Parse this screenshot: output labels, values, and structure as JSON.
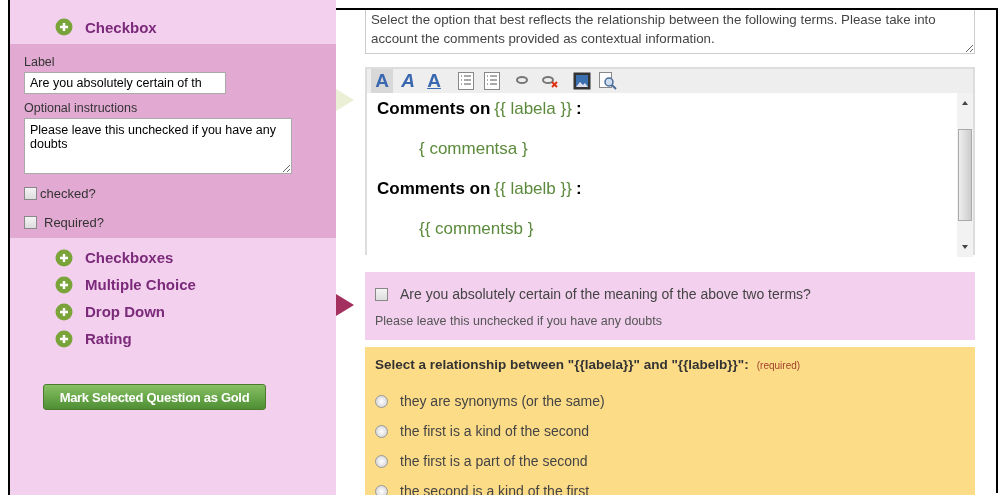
{
  "sidebar": {
    "items": [
      {
        "label": "Checkbox",
        "expanded": true,
        "editor": {
          "label_caption": "Label",
          "label_value": "Are you absolutely certain of th",
          "instructions_caption": "Optional instructions",
          "instructions_value": "Please leave this unchecked if you have any doubts",
          "options": [
            {
              "label": "checked?",
              "checked": false
            },
            {
              "label": "Required?",
              "checked": false
            }
          ]
        }
      },
      {
        "label": "Checkboxes",
        "expanded": false
      },
      {
        "label": "Multiple Choice",
        "expanded": false
      },
      {
        "label": "Drop Down",
        "expanded": false
      },
      {
        "label": "Rating",
        "expanded": false
      }
    ],
    "gold_button": "Mark Selected Question as Gold"
  },
  "instructions_field": {
    "value": "Select the option that best reflects the relationship between the following terms. Please take into account the comments provided as contextual information."
  },
  "rich_editor": {
    "toolbar": [
      {
        "kind": "bold",
        "glyph": "A",
        "selected": true
      },
      {
        "kind": "italic",
        "glyph": "A",
        "selected": false
      },
      {
        "kind": "underline",
        "glyph": "A",
        "selected": false
      },
      {
        "kind": "bullets",
        "selected": false
      },
      {
        "kind": "numbering",
        "selected": false
      },
      {
        "kind": "link",
        "selected": false
      },
      {
        "kind": "unlink",
        "selected": false
      },
      {
        "kind": "image",
        "selected": false
      },
      {
        "kind": "preview",
        "selected": false
      }
    ],
    "content": [
      {
        "kind": "heading",
        "text": "Comments on",
        "variable": "{{ labela }}",
        "suffix": ":"
      },
      {
        "kind": "variable",
        "text": "{ commentsa }"
      },
      {
        "kind": "heading",
        "text": "Comments on",
        "variable": "{{ labelb }}",
        "suffix": ":"
      },
      {
        "kind": "variable",
        "text": "{{ commentsb }"
      }
    ]
  },
  "preview": {
    "questions": [
      {
        "kind": "checkbox",
        "selected": true,
        "label": "Are you absolutely certain of the meaning of the above two terms?",
        "checked": false,
        "instructions": "Please leave this unchecked if you have any doubts"
      },
      {
        "kind": "radio",
        "selected": false,
        "label": "Select a relationship between \"{{labela}}\" and \"{{labelb}}\":",
        "required": "(required)",
        "options": [
          {
            "label": "they are synonyms (or the same)",
            "selected": false
          },
          {
            "label": "the first is a kind of the second",
            "selected": false
          },
          {
            "label": "the first is a part of the second",
            "selected": false
          },
          {
            "label": "the second is a kind of the first",
            "selected": false
          }
        ]
      }
    ]
  }
}
